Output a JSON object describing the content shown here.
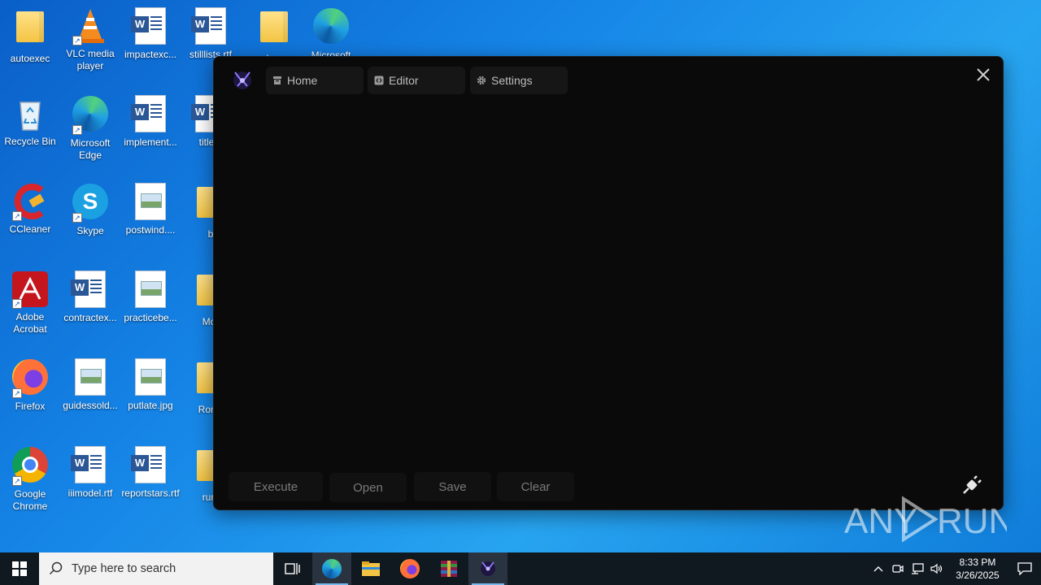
{
  "desktop": {
    "icons": [
      {
        "label": "autoexec"
      },
      {
        "label": "VLC media player"
      },
      {
        "label": "impactexc..."
      },
      {
        "label": "stilllists.rtf"
      },
      {
        "label": "workspace"
      },
      {
        "label": "Microsoft"
      },
      {
        "label": "Recycle Bin"
      },
      {
        "label": "Microsoft Edge"
      },
      {
        "label": "implement..."
      },
      {
        "label": "titleot"
      },
      {
        "label": "CCleaner"
      },
      {
        "label": "Skype"
      },
      {
        "label": "postwind...."
      },
      {
        "label": "b"
      },
      {
        "label": "Adobe Acrobat"
      },
      {
        "label": "contractex..."
      },
      {
        "label": "practicebe..."
      },
      {
        "label": "Mor"
      },
      {
        "label": "Firefox"
      },
      {
        "label": "guidessold..."
      },
      {
        "label": "putlate.jpg"
      },
      {
        "label": "Ronix"
      },
      {
        "label": "Google Chrome"
      },
      {
        "label": "iiimodel.rtf"
      },
      {
        "label": "reportstars.rtf"
      },
      {
        "label": "runt"
      }
    ]
  },
  "app": {
    "tabs": [
      {
        "label": "Home",
        "icon": "archive-icon"
      },
      {
        "label": "Editor",
        "icon": "code-icon"
      },
      {
        "label": "Settings",
        "icon": "gear-icon"
      }
    ],
    "buttons": {
      "execute": "Execute",
      "open": "Open",
      "save": "Save",
      "clear": "Clear"
    }
  },
  "watermark": {
    "text_left": "ANY",
    "text_right": "RUN"
  },
  "taskbar": {
    "search_placeholder": "Type here to search",
    "time": "8:33 PM",
    "date": "3/26/2025"
  },
  "colors": {
    "app_background": "#0a0a0a",
    "tab_background": "#161616",
    "taskbar": "#101820"
  }
}
